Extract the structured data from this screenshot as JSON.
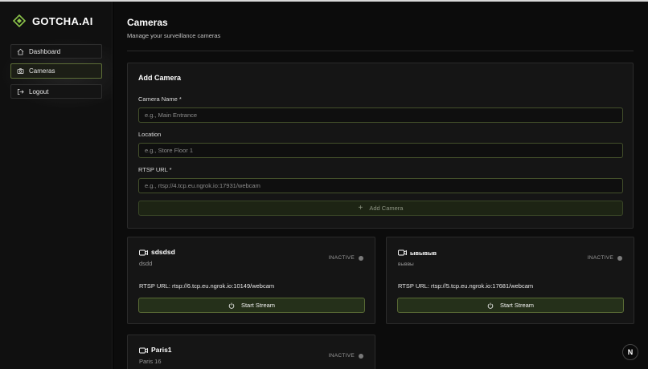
{
  "brand": {
    "name": "GOTCHA.AI",
    "color": "#8bc34a"
  },
  "sidebar": {
    "items": [
      {
        "label": "Dashboard",
        "icon": "home-icon",
        "active": false
      },
      {
        "label": "Cameras",
        "icon": "camera-icon",
        "active": true
      },
      {
        "label": "Logout",
        "icon": "logout-icon",
        "active": false
      }
    ]
  },
  "header": {
    "title": "Cameras",
    "subtitle": "Manage your surveillance cameras"
  },
  "add_camera": {
    "title": "Add Camera",
    "fields": [
      {
        "label": "Camera Name *",
        "placeholder": "e.g., Main Entrance",
        "value": ""
      },
      {
        "label": "Location",
        "placeholder": "e.g., Store Floor 1",
        "value": ""
      },
      {
        "label": "RTSP URL *",
        "placeholder": "e.g., rtsp://4.tcp.eu.ngrok.io:17931/webcam",
        "value": ""
      }
    ],
    "button_label": "Add Camera"
  },
  "cameras": [
    {
      "name": "sdsdsd",
      "location": "dsdd",
      "status": "INACTIVE",
      "rtsp": "RTSP URL: rtsp://6.tcp.eu.ngrok.io:10149/webcam",
      "button": "Start Stream"
    },
    {
      "name": "ывывыв",
      "location": "выввы",
      "status": "INACTIVE",
      "rtsp": "RTSP URL: rtsp://5.tcp.eu.ngrok.io:17681/webcam",
      "button": "Start Stream"
    },
    {
      "name": "Paris1",
      "location": "Paris 16",
      "status": "INACTIVE",
      "rtsp": "",
      "button": ""
    }
  ],
  "fab": {
    "label": "N"
  },
  "colors": {
    "accent": "#8bc34a",
    "border_accent": "#5a6b35",
    "status_inactive": "#7a7a7a"
  }
}
